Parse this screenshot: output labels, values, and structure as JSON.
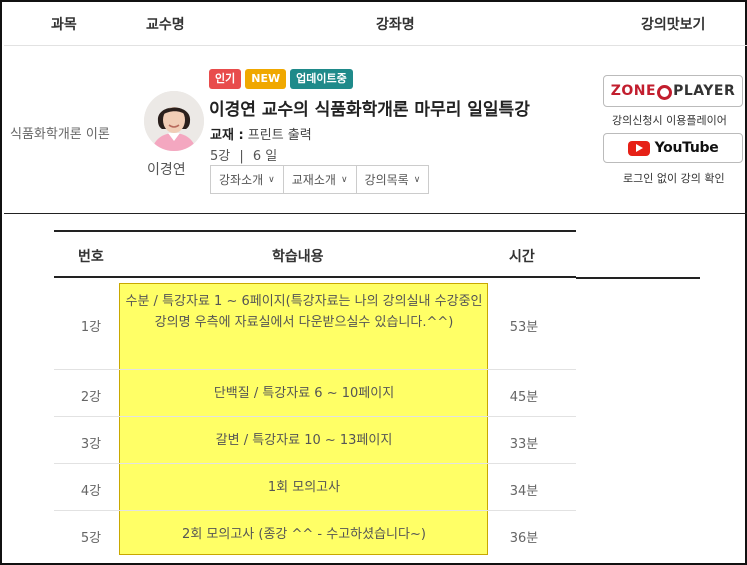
{
  "table_header": {
    "subject": "과목",
    "professor": "교수명",
    "course": "강좌명",
    "preview": "강의맛보기"
  },
  "course": {
    "subject": "식품화학개론 이론",
    "professor": "이경연",
    "badges": [
      "인기",
      "NEW",
      "업데이트중"
    ],
    "title": "이경연 교수의 식품화학개론 마무리 일일특강",
    "textbook_label": "교재 :",
    "textbook_value": "프린트 출력",
    "lectures": "5강",
    "separator": "|",
    "days": "6 일",
    "menu": [
      "강좌소개",
      "교재소개",
      "강의목록"
    ]
  },
  "preview": {
    "zone_player": {
      "left": "ZONE",
      "right": "PLAYER"
    },
    "zone_caption": "강의신청시 이용플레이어",
    "youtube_label": "YouTube",
    "youtube_caption": "로그인 없이 강의 확인"
  },
  "lecture_table": {
    "headers": {
      "number": "번호",
      "content": "학습내용",
      "time": "시간"
    },
    "rows": [
      {
        "number": "1강",
        "content": "수분 / 특강자료 1 ~ 6페이지(특강자료는 나의 강의실내 수강중인 강의명 우측에 자료실에서 다운받으실수 있습니다.^^)",
        "time": "53분"
      },
      {
        "number": "2강",
        "content": "단백질 / 특강자료 6 ~ 10페이지",
        "time": "45분"
      },
      {
        "number": "3강",
        "content": "갈변 / 특강자료 10 ~ 13페이지",
        "time": "33분"
      },
      {
        "number": "4강",
        "content": "1회 모의고사",
        "time": "34분"
      },
      {
        "number": "5강",
        "content": "2회 모의고사 (종강 ^^ - 수고하셨습니다~)",
        "time": "36분"
      }
    ]
  },
  "colors": {
    "highlight": "#ffff66",
    "badge_hot": "#e84c4c",
    "badge_new": "#f0a800",
    "badge_update": "#1f8a8a",
    "zone_red": "#c21e2e",
    "youtube_red": "#e62117"
  }
}
